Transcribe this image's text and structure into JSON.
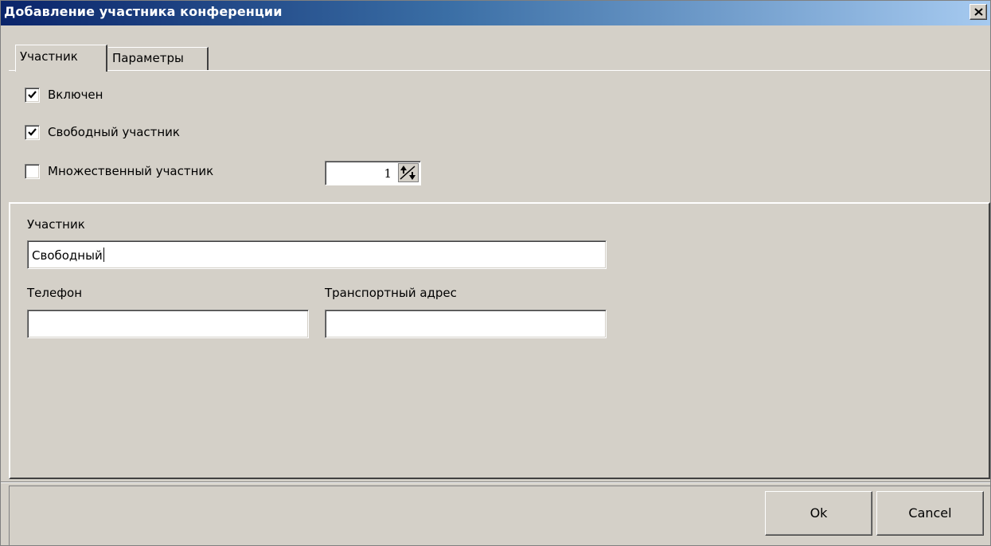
{
  "window": {
    "title": "Добавление участника конференции",
    "close_icon": "close-icon"
  },
  "tabs": [
    {
      "label": "Участник",
      "active": true
    },
    {
      "label": "Параметры",
      "active": false
    }
  ],
  "options": {
    "enabled": {
      "label": "Включен",
      "checked": true
    },
    "free_participant": {
      "label": "Свободный участник",
      "checked": true
    },
    "multiple_participant": {
      "label": "Множественный участник",
      "checked": false
    },
    "count": {
      "value": "1"
    }
  },
  "form": {
    "participant": {
      "label": "Участник",
      "value": "Свободный"
    },
    "phone": {
      "label": "Телефон",
      "value": ""
    },
    "transport_address": {
      "label": "Транспортный адрес",
      "value": ""
    }
  },
  "buttons": {
    "ok": "Ok",
    "cancel": "Cancel"
  }
}
